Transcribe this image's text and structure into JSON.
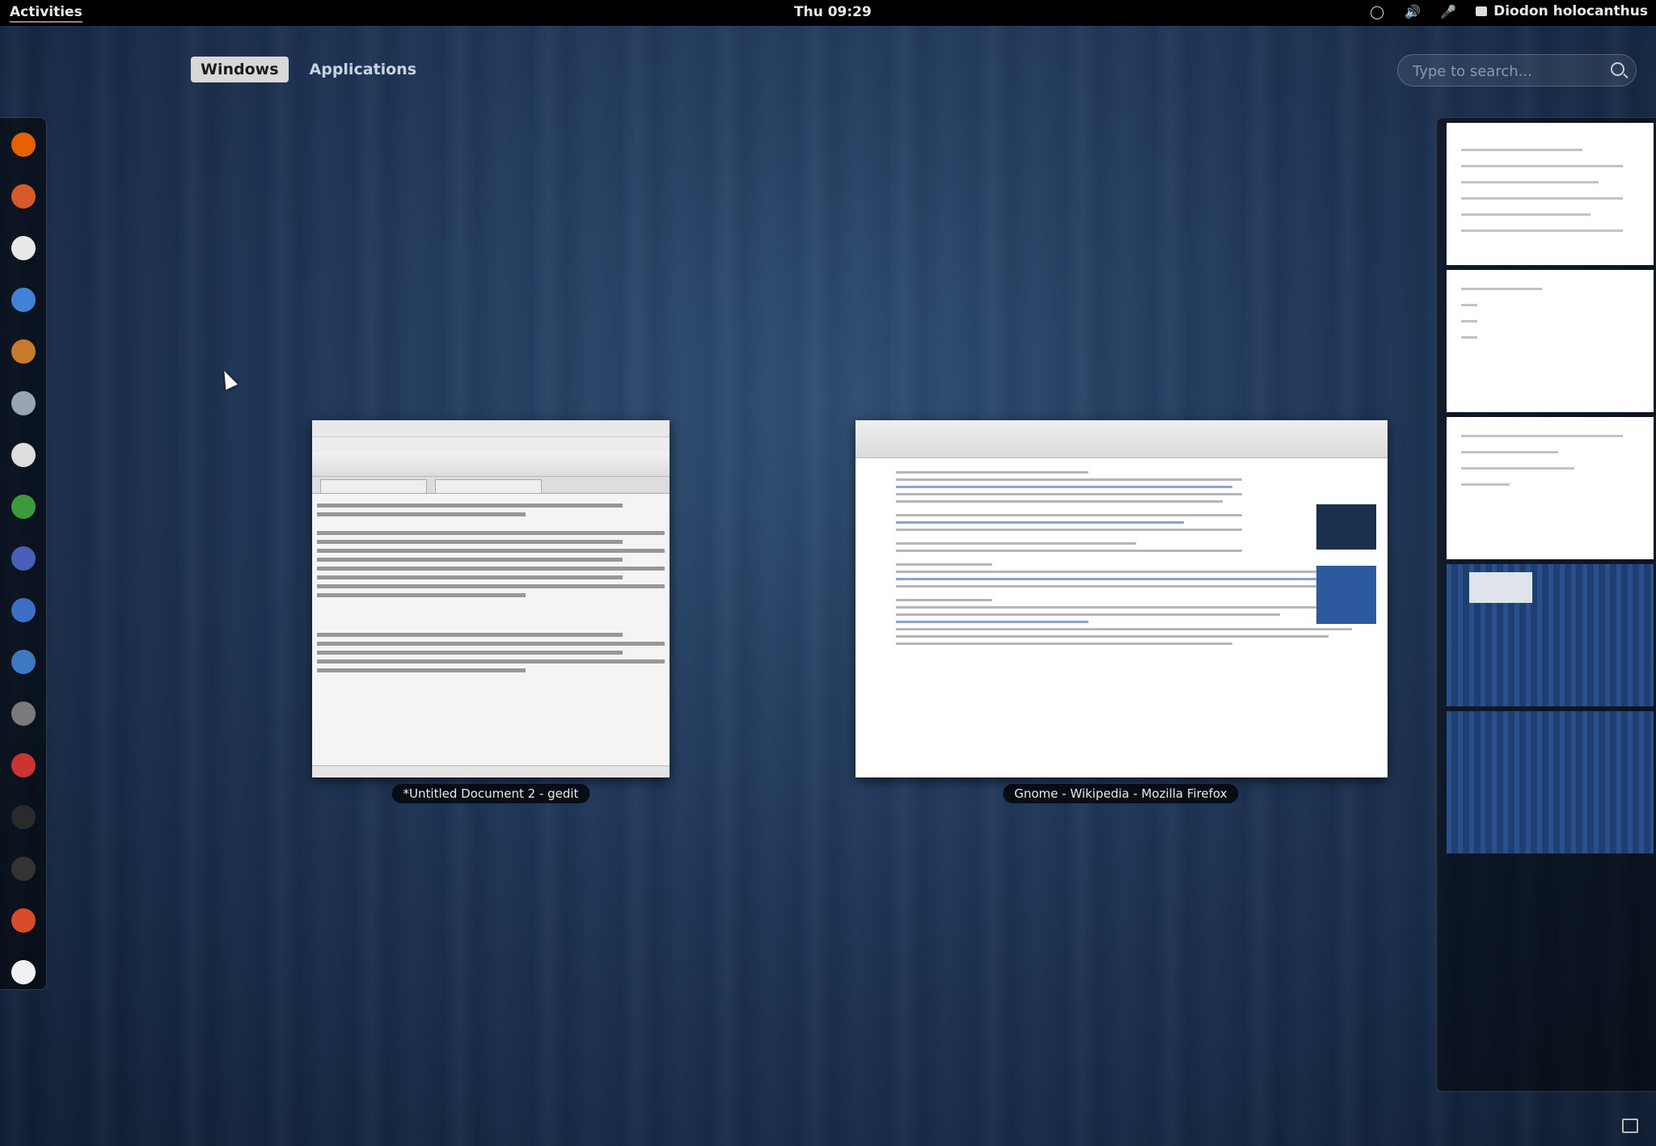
{
  "topbar": {
    "activities": "Activities",
    "clock": "Thu 09:29",
    "user": "Diodon holocanthus"
  },
  "overview": {
    "tabs": [
      "Windows",
      "Applications"
    ],
    "active_tab": "Windows",
    "search_placeholder": "Type to search..."
  },
  "windows": [
    {
      "title": "*Untitled Document 2 - gedit"
    },
    {
      "title": "Gnome - Wikipedia - Mozilla Firefox"
    }
  ],
  "dash": {
    "apps": [
      {
        "icon": "firefox-icon",
        "color": "#e66000"
      },
      {
        "icon": "file-manager-icon",
        "color": "#d65a2a"
      },
      {
        "icon": "disk-icon",
        "color": "#e8e8e8"
      },
      {
        "icon": "empathy-icon",
        "color": "#3f82d6"
      },
      {
        "icon": "library-icon",
        "color": "#c77b2a"
      },
      {
        "icon": "gimp-icon",
        "color": "#9aa5b1"
      },
      {
        "icon": "media-player-icon",
        "color": "#dddddd"
      },
      {
        "icon": "vim-icon",
        "color": "#3c9a3c"
      },
      {
        "icon": "eclipse-icon",
        "color": "#4b5fb8"
      },
      {
        "icon": "globe-icon",
        "color": "#3b6fc4"
      },
      {
        "icon": "python-icon",
        "color": "#3e78c2"
      },
      {
        "icon": "movie-editor-icon",
        "color": "#7a7a7a"
      },
      {
        "icon": "package-installer-icon",
        "color": "#cc3333"
      },
      {
        "icon": "system-monitor-icon",
        "color": "#2a2a2a"
      },
      {
        "icon": "terminal-icon",
        "color": "#333333"
      },
      {
        "icon": "software-center-icon",
        "color": "#d94b2b"
      },
      {
        "icon": "text-editor-icon",
        "color": "#f0f0f0"
      }
    ]
  }
}
